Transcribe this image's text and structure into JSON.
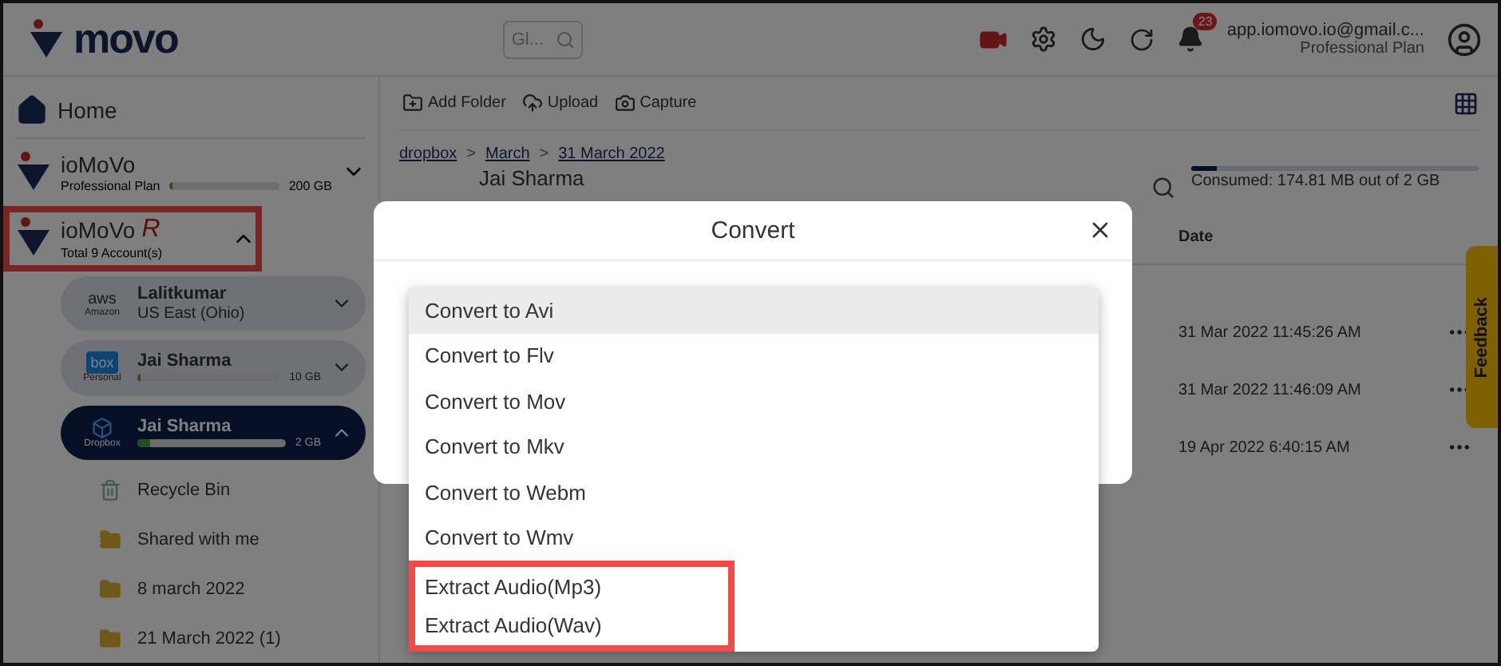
{
  "header": {
    "brand": "movo",
    "search": {
      "placeholder": "Gl..."
    },
    "notifications": "23",
    "email": "app.iomovo.io@gmail.c...",
    "plan": "Professional Plan"
  },
  "sidebar": {
    "home": "Home",
    "workspaces": [
      {
        "name": "ioMoVo",
        "sub": "Professional Plan",
        "level": 0.02,
        "size": "200 GB",
        "expanded": false,
        "highlighted": false
      },
      {
        "name": "ioMoVo",
        "tag": "R",
        "sub": "Total 9 Account(s)",
        "expanded": true,
        "highlighted": true
      }
    ],
    "accounts": [
      {
        "kind": "aws",
        "logo": "aws",
        "provider": "Amazon",
        "name": "Lalitkumar",
        "detail": "US East (Ohio)",
        "selected": false,
        "expanded": false
      },
      {
        "kind": "box",
        "logo": "box",
        "provider": "Personal",
        "name": "Jai Sharma",
        "level": 0.02,
        "size": "10 GB",
        "selected": false,
        "expanded": false
      },
      {
        "kind": "dropbox",
        "provider": "Dropbox",
        "name": "Jai Sharma",
        "level": 0.09,
        "size": "2 GB",
        "selected": true,
        "expanded": true
      }
    ],
    "folders": [
      {
        "kind": "bin",
        "label": "Recycle Bin"
      },
      {
        "kind": "shared",
        "label": "Shared with me"
      },
      {
        "kind": "folder",
        "label": "8 march 2022"
      },
      {
        "kind": "folder",
        "label": "21 March 2022 (1)"
      }
    ]
  },
  "toolbar": [
    "Add Folder",
    "Upload",
    "Capture"
  ],
  "breadcrumb": {
    "separator": ">",
    "items": [
      "dropbox",
      "March",
      "31 March 2022"
    ]
  },
  "title": "Jai Sharma",
  "storage": {
    "level": 0.09,
    "text": "Consumed: 174.81 MB out of 2 GB"
  },
  "table": {
    "columns": [
      "Date"
    ],
    "rows": [
      {
        "date": "31 Mar 2022 11:45:26 AM"
      },
      {
        "date": "31 Mar 2022 11:46:09 AM"
      },
      {
        "date": "19 Apr 2022 6:40:15 AM"
      }
    ]
  },
  "feedback": "Feedback",
  "dialog": {
    "title": "Convert",
    "options": [
      {
        "label": "Convert to Avi",
        "selected": true,
        "highlighted": false
      },
      {
        "label": "Convert to Flv",
        "selected": false,
        "highlighted": false
      },
      {
        "label": "Convert to Mov",
        "selected": false,
        "highlighted": false
      },
      {
        "label": "Convert to Mkv",
        "selected": false,
        "highlighted": false
      },
      {
        "label": "Convert to Webm",
        "selected": false,
        "highlighted": false
      },
      {
        "label": "Convert to Wmv",
        "selected": false,
        "highlighted": false
      },
      {
        "label": "Extract Audio(Mp3)",
        "selected": false,
        "highlighted": true
      },
      {
        "label": "Extract Audio(Wav)",
        "selected": false,
        "highlighted": true
      }
    ]
  }
}
